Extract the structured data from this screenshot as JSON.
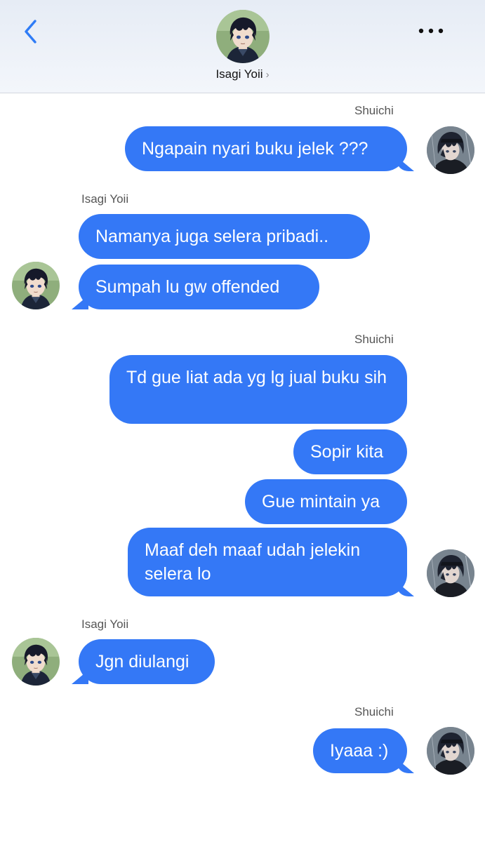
{
  "header": {
    "contact_name": "Isagi Yoii",
    "chevron": "›",
    "back_icon": "chevron-left-icon",
    "more_icon": "ellipsis-icon"
  },
  "colors": {
    "bubble": "#3478f6",
    "accent": "#2f7cf6",
    "header_bg": "#eef2f8"
  },
  "messages": [
    {
      "sender": "Shuichi",
      "text": "Ngapain nyari buku jelek ???"
    },
    {
      "sender": "Isagi Yoii",
      "text": "Namanya juga selera pribadi.."
    },
    {
      "text": "Sumpah lu gw offended"
    },
    {
      "sender": "Shuichi",
      "text": "Td gue liat ada yg lg jual buku sih"
    },
    {
      "text": "Sopir kita"
    },
    {
      "text": "Gue mintain ya"
    },
    {
      "text": "Maaf deh maaf udah jelekin selera lo"
    },
    {
      "sender": "Isagi Yoii",
      "text": "Jgn diulangi"
    },
    {
      "sender": "Shuichi",
      "text": "Iyaaa :)"
    }
  ]
}
